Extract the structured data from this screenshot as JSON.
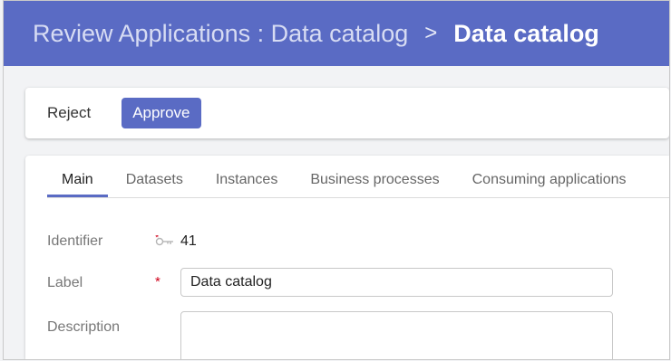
{
  "header": {
    "crumb": "Review Applications : Data catalog",
    "separator": ">",
    "title": "Data catalog"
  },
  "actions": {
    "reject": "Reject",
    "approve": "Approve"
  },
  "tabs": [
    "Main",
    "Datasets",
    "Instances",
    "Business processes",
    "Consuming applications"
  ],
  "form": {
    "identifier_label": "Identifier",
    "identifier_value": "41",
    "label_label": "Label",
    "label_value": "Data catalog",
    "description_label": "Description",
    "description_value": "",
    "required_mark": "*"
  },
  "colors": {
    "accent": "#5a6bc4",
    "required": "#d0021b"
  }
}
